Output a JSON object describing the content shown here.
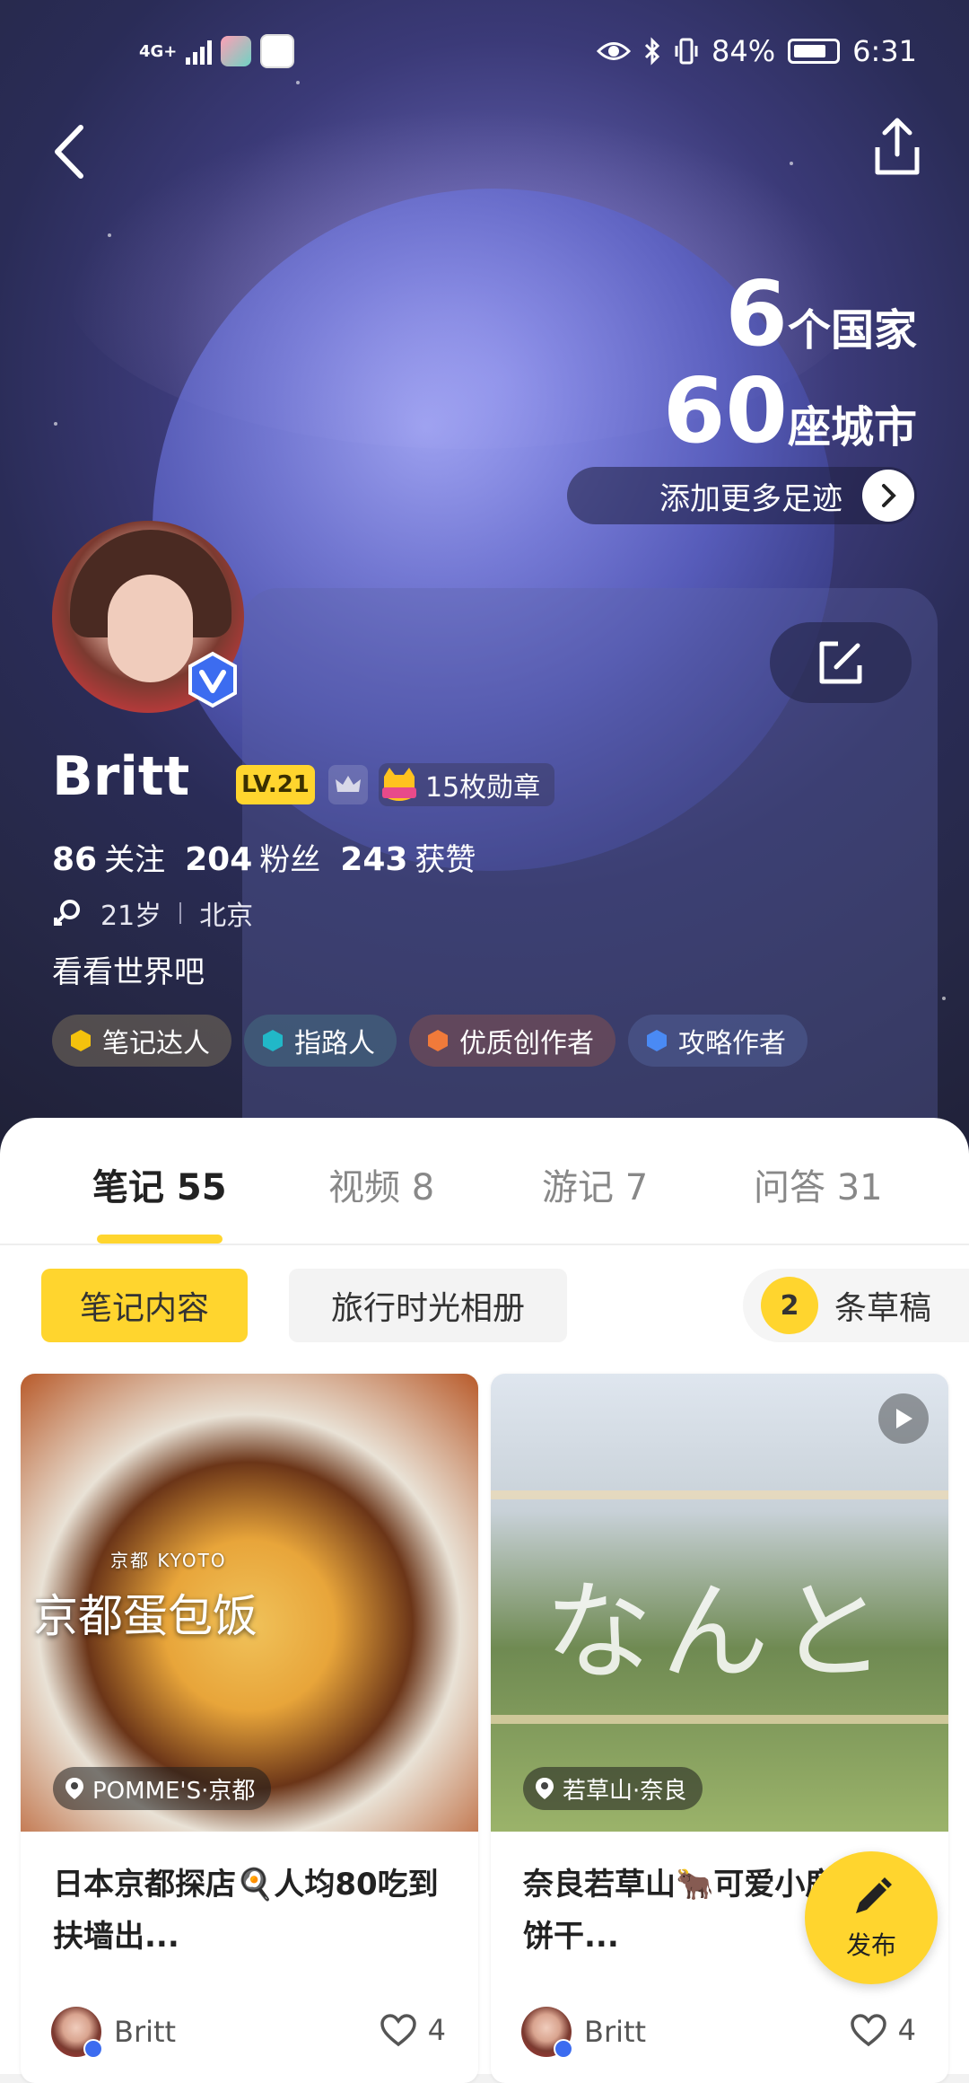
{
  "status_bar": {
    "network": "4G+",
    "battery": "84%",
    "time": "6:31"
  },
  "profile": {
    "countries_num": "6",
    "countries_unit": "个国家",
    "cities_num": "60",
    "cities_unit": "座城市",
    "add_trail": "添加更多足迹",
    "name": "Britt",
    "level": "LV.21",
    "medals": "15枚勋章",
    "following_num": "86",
    "following_label": "关注",
    "fans_num": "204",
    "fans_label": "粉丝",
    "likes_num": "243",
    "likes_label": "获赞",
    "age": "21岁",
    "city": "北京",
    "bio": "看看世界吧",
    "tags": [
      {
        "label": "笔记达人",
        "color": "#f4c20d"
      },
      {
        "label": "指路人",
        "color": "#21b8c8"
      },
      {
        "label": "优质创作者",
        "color": "#f07a3a"
      },
      {
        "label": "攻略作者",
        "color": "#4a8af4"
      }
    ]
  },
  "tabs": [
    {
      "label": "笔记 55"
    },
    {
      "label": "视频 8"
    },
    {
      "label": "游记 7"
    },
    {
      "label": "问答 31"
    }
  ],
  "subtabs": {
    "notes": "笔记内容",
    "album": "旅行时光相册",
    "draft_count": "2",
    "draft_label": "条草稿"
  },
  "cards": [
    {
      "overlay_small": "京都 KYOTO",
      "overlay_title": "京都蛋包饭",
      "location": "POMME'S·京都",
      "title": "日本京都探店🍳人均80吃到扶墙出...",
      "author": "Britt",
      "likes": "4"
    },
    {
      "overlay_title": "なんと",
      "location": "若草山·奈良",
      "title": "奈良若草山🐂可爱小鹿线抢饼干...",
      "author": "Britt",
      "likes": "4"
    }
  ],
  "publish": "发布"
}
